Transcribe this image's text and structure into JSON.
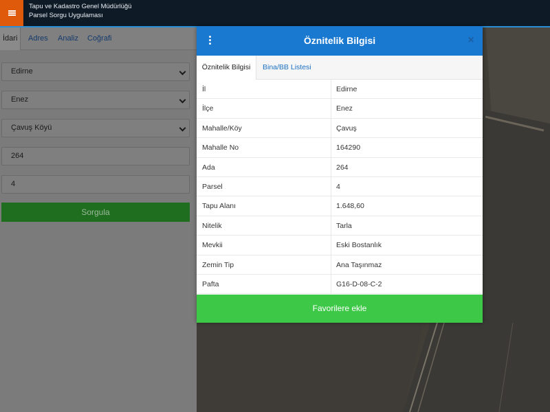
{
  "header": {
    "org_name": "Tapu ve Kadastro Genel Müdürlüğü",
    "app_name": "Parsel Sorgu Uygulaması"
  },
  "left_panel": {
    "tabs": [
      {
        "label": "İdari",
        "active": true
      },
      {
        "label": "Adres"
      },
      {
        "label": "Analiz"
      },
      {
        "label": "Coğrafi"
      }
    ],
    "fields": {
      "il": "Edirne",
      "ilce": "Enez",
      "mahalle": "Çavuş Köyü",
      "ada": "264",
      "parsel": "4"
    },
    "query_label": "Sorgula"
  },
  "dialog": {
    "title": "Öznitelik Bilgisi",
    "close_symbol": "×",
    "tabs": [
      {
        "label": "Öznitelik Bilgisi",
        "active": true
      },
      {
        "label": "Bina/BB Listesi"
      }
    ],
    "rows": [
      {
        "key": "İl",
        "value": "Edirne"
      },
      {
        "key": "İlçe",
        "value": "Enez"
      },
      {
        "key": "Mahalle/Köy",
        "value": "Çavuş"
      },
      {
        "key": "Mahalle No",
        "value": "164290"
      },
      {
        "key": "Ada",
        "value": "264"
      },
      {
        "key": "Parsel",
        "value": "4"
      },
      {
        "key": "Tapu Alanı",
        "value": "1.648,60"
      },
      {
        "key": "Nitelik",
        "value": "Tarla"
      },
      {
        "key": "Mevkii",
        "value": "Eski Bostanlık"
      },
      {
        "key": "Zemin Tip",
        "value": "Ana Taşınmaz"
      },
      {
        "key": "Pafta",
        "value": "G16-D-08-C-2"
      }
    ],
    "favorite_label": "Favorilere ekle"
  },
  "colors": {
    "header_bg": "#0e1a26",
    "menu_accent": "#e05a0c",
    "dialog_header": "#1979d1",
    "favorite_button": "#3ec848",
    "query_button": "#1f6d1f"
  },
  "icons": {
    "menu": "hamburger-icon",
    "dialog_menu": "kebab-menu-icon",
    "close": "close-icon",
    "select": "chevron-down-icon"
  }
}
